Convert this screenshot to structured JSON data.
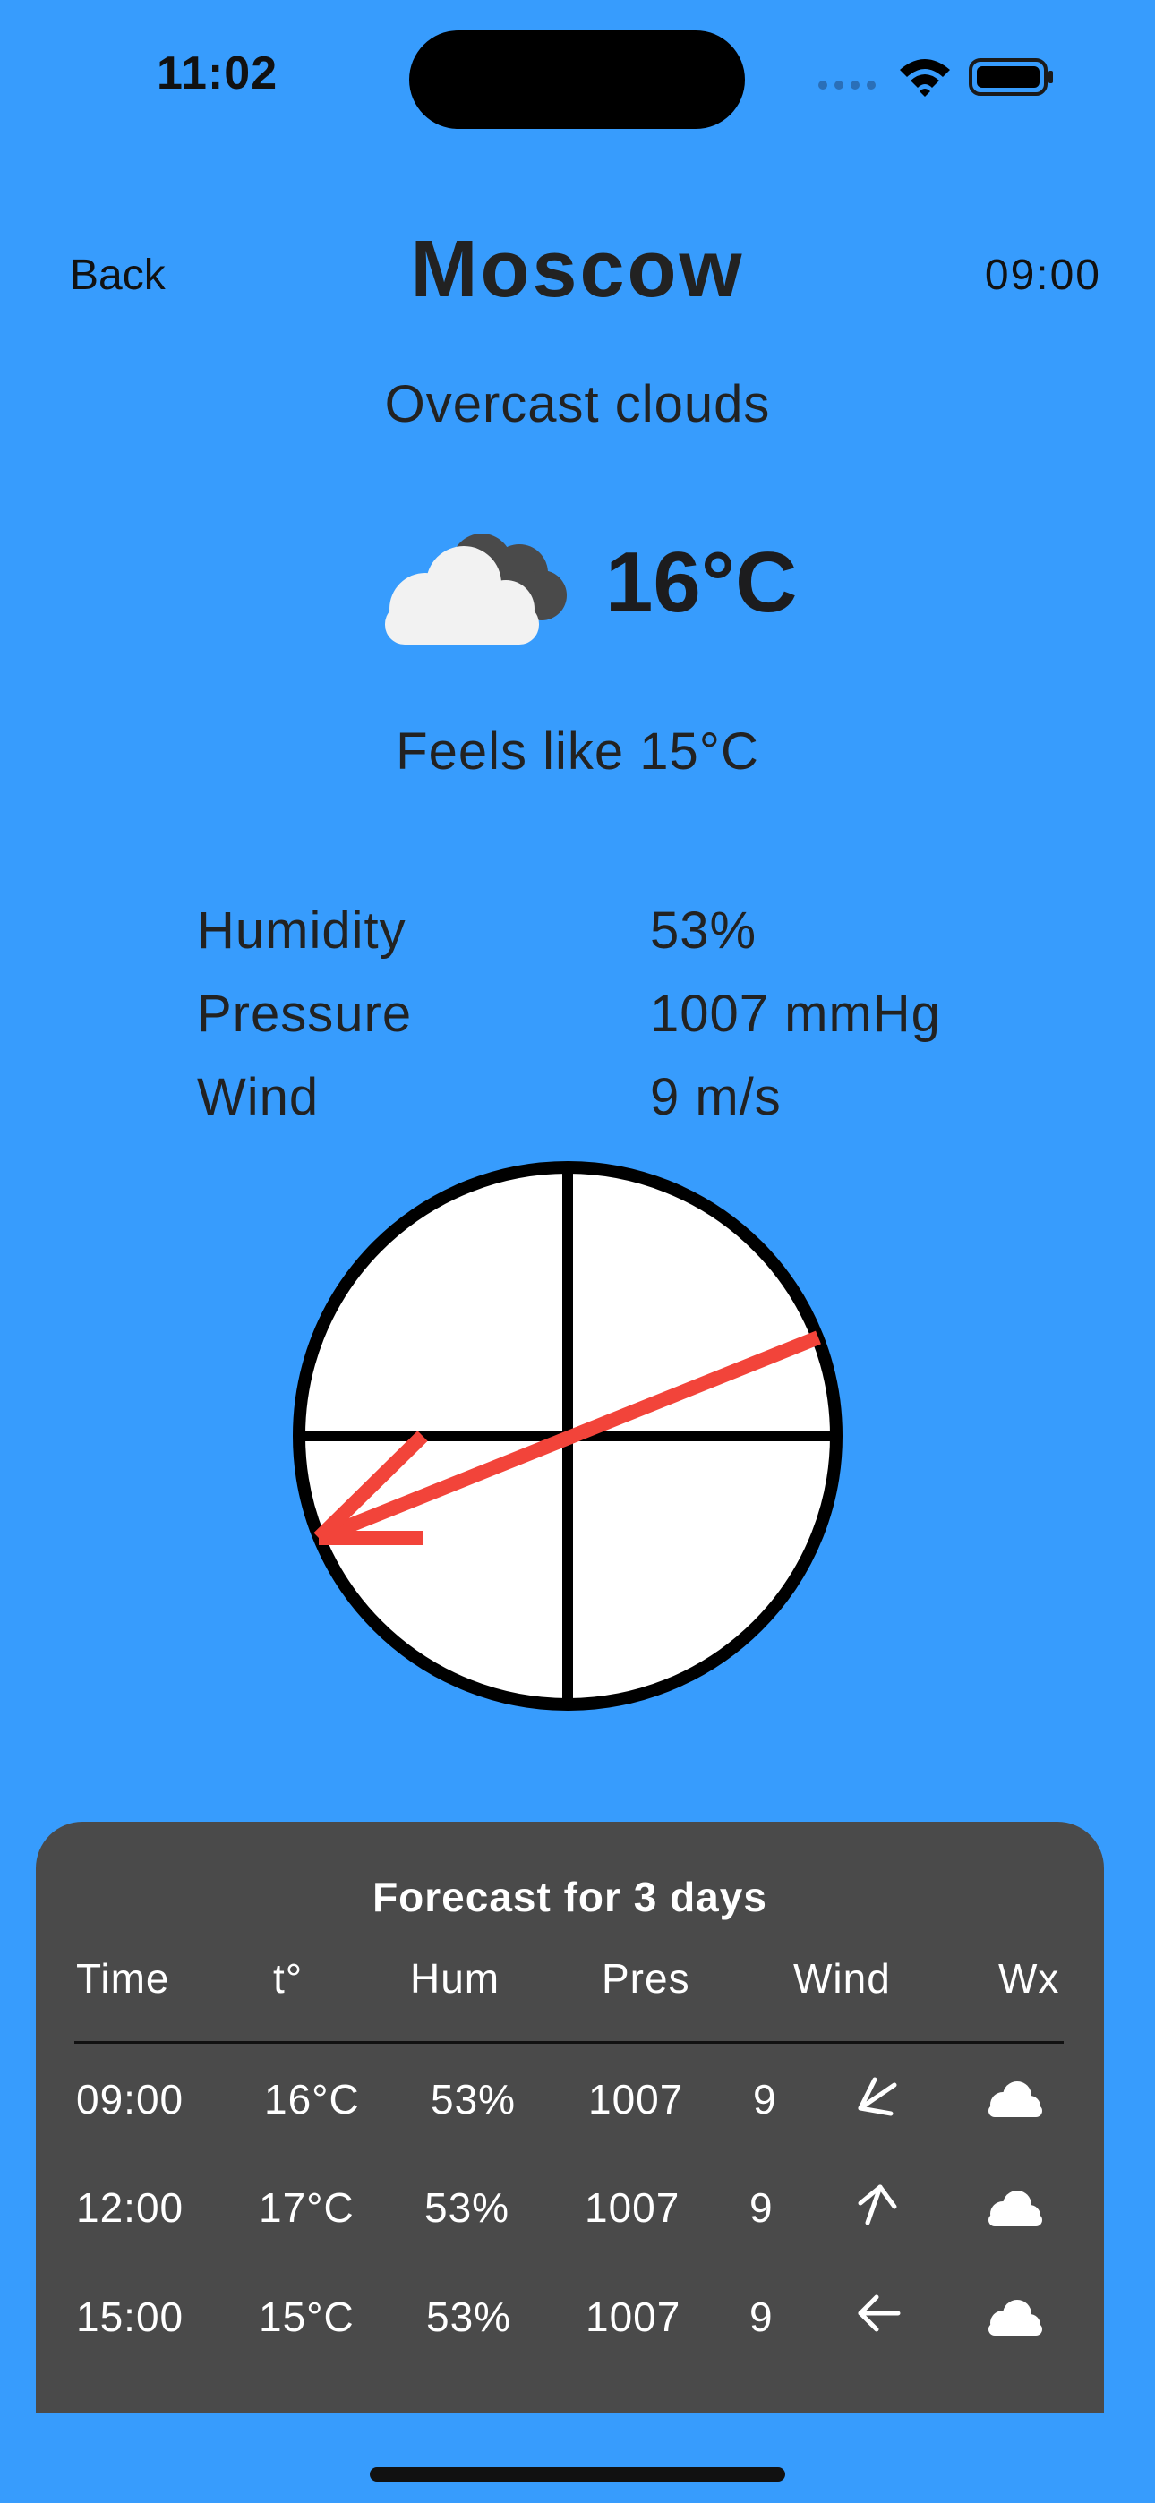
{
  "status_bar": {
    "time": "11:02"
  },
  "header": {
    "back_label": "Back",
    "city": "Moscow",
    "selected_time": "09:00"
  },
  "current": {
    "condition": "Overcast clouds",
    "icon": "overcast-clouds-icon",
    "temperature": "16°C",
    "feels_like": "Feels like 15°C"
  },
  "stats": [
    {
      "label": "Humidity",
      "value": "53%"
    },
    {
      "label": "Pressure",
      "value": "1007 mmHg"
    },
    {
      "label": "Wind",
      "value": "9 m/s"
    }
  ],
  "compass": {
    "wind_direction_icon": "wind-direction-arrow",
    "arrow_color": "#f2443a"
  },
  "forecast": {
    "title": "Forecast for 3 days",
    "columns": [
      "Time",
      "t°",
      "Hum",
      "Pres",
      "Wind",
      "Wx"
    ],
    "rows": [
      {
        "time": "09:00",
        "temp": "16°C",
        "hum": "53%",
        "pres": "1007",
        "wind": "9",
        "direction_icon": "arrow-down-left-icon",
        "wx_icon": "cloud-icon"
      },
      {
        "time": "12:00",
        "temp": "17°C",
        "hum": "53%",
        "pres": "1007",
        "wind": "9",
        "direction_icon": "arrow-up-icon",
        "wx_icon": "cloud-icon"
      },
      {
        "time": "15:00",
        "temp": "15°C",
        "hum": "53%",
        "pres": "1007",
        "wind": "9",
        "direction_icon": "arrow-left-icon",
        "wx_icon": "cloud-icon"
      }
    ]
  },
  "colors": {
    "background": "#379cfd",
    "panel": "#4a4a4a",
    "accent": "#f2443a"
  }
}
